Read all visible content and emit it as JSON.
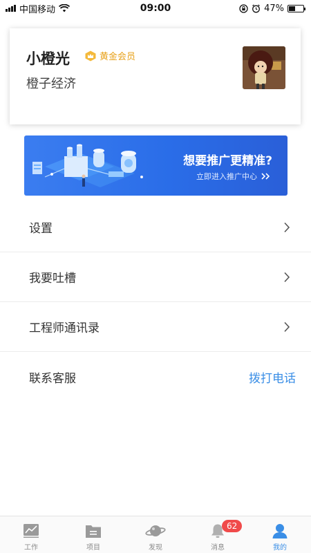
{
  "status_bar": {
    "carrier": "中国移动",
    "time": "09:00",
    "battery": "47%",
    "battery_level": 0.47,
    "icons": [
      "signal-icon",
      "wifi-icon",
      "lock-rotation-icon",
      "alarm-icon",
      "battery-icon"
    ]
  },
  "profile": {
    "name": "小橙光",
    "member_label": "黄金会员",
    "company": "橙子经济",
    "badge_color": "#e8a11a"
  },
  "promo": {
    "title": "想要推广更精准?",
    "subtitle": "立即进入推广中心",
    "colors": {
      "start": "#3b7df0",
      "end": "#2a5fd8"
    }
  },
  "menu": {
    "items": [
      {
        "label": "设置"
      },
      {
        "label": "我要吐槽"
      },
      {
        "label": "工程师通讯录"
      }
    ],
    "contact": {
      "label": "联系客服",
      "action": "拨打电话"
    }
  },
  "tabs": {
    "items": [
      {
        "label": "工作",
        "icon": "chart-icon"
      },
      {
        "label": "项目",
        "icon": "folder-icon"
      },
      {
        "label": "发现",
        "icon": "planet-icon"
      },
      {
        "label": "消息",
        "icon": "bell-icon",
        "badge": "62"
      },
      {
        "label": "我的",
        "icon": "person-icon",
        "active": true
      }
    ],
    "active_color": "#3a8ee6",
    "badge_color": "#f04a4a"
  }
}
